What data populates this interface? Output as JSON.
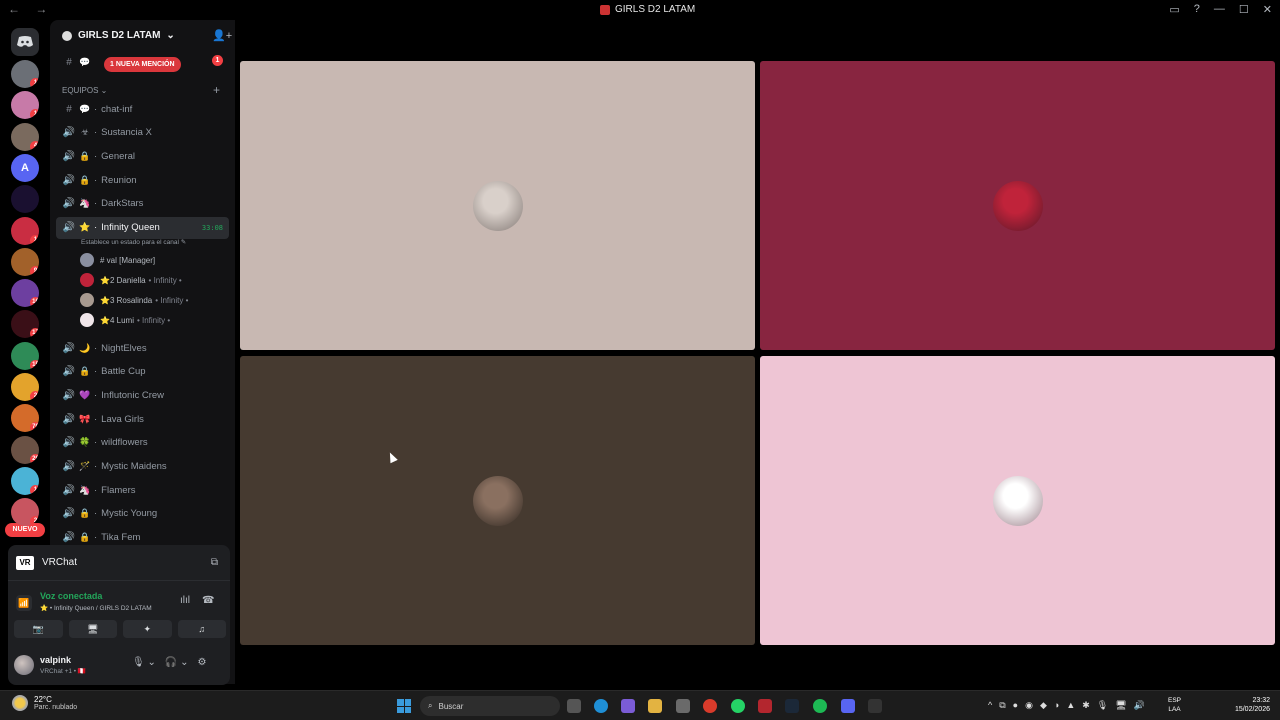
{
  "window": {
    "title": "GIRLS D2 LATAM",
    "nav": "← →",
    "controls": [
      "▭",
      "?",
      "—",
      "☐",
      "✕"
    ]
  },
  "servers": [
    {
      "badge": "1",
      "color": "#6b6f76"
    },
    {
      "badge": "1",
      "color": "#c77aa8"
    },
    {
      "badge": "4",
      "color": "#7a6a5e"
    },
    {
      "badge": "",
      "color": "#5865f2",
      "letter": "A"
    },
    {
      "badge": "",
      "color": "#1a1030"
    },
    {
      "badge": "1",
      "color": "#c92d42"
    },
    {
      "badge": "9",
      "color": "#a2612a"
    },
    {
      "badge": "16",
      "color": "#6d3fa0"
    },
    {
      "badge": "17",
      "color": "#3a0f17"
    },
    {
      "badge": "15",
      "color": "#2e8b57"
    },
    {
      "badge": "2",
      "color": "#e3a32c"
    },
    {
      "badge": "70",
      "color": "#d46b2a"
    },
    {
      "badge": "26",
      "color": "#6a5144"
    },
    {
      "badge": "1",
      "color": "#4bb3d6"
    },
    {
      "badge": "2",
      "color": "#c85560"
    }
  ],
  "nuevo_label": "NUEVO",
  "server_header": {
    "name": "GIRLS D2 LATAM",
    "chevron": "⌄"
  },
  "mention_label": "1 NUEVA MENCIÓN",
  "mention_badge": "1",
  "category": {
    "name": "EQUIPOS ⌄",
    "add": "+"
  },
  "channels": [
    {
      "icon": "#",
      "emoji": "💬",
      "name": "chat-inf",
      "type": "text"
    },
    {
      "icon": "🔊",
      "emoji": "☣",
      "name": "Sustancia X"
    },
    {
      "icon": "🔊",
      "emoji": "🔒",
      "name": "General"
    },
    {
      "icon": "🔊",
      "emoji": "🔒",
      "name": "Reunion"
    },
    {
      "icon": "🔊",
      "emoji": "🦄",
      "name": "DarkStars"
    },
    {
      "icon": "🔊",
      "emoji": "⭐",
      "name": "Infinity Queen",
      "active": true,
      "timer": "33:08"
    }
  ],
  "channel_status": "Establece un estado para el canal ✎",
  "voice_users": [
    {
      "name": "# val [Manager]",
      "sub": "",
      "color": "#8a8fa0"
    },
    {
      "name": "⭐2 Daniella",
      "sub": "• Infinity •",
      "color": "#c0233a"
    },
    {
      "name": "⭐3 Rosalinda",
      "sub": "• Infinity •",
      "color": "#a89a90"
    },
    {
      "name": "⭐4 Lumi",
      "sub": "• Infinity •",
      "color": "#f0e6ea"
    }
  ],
  "channels2": [
    {
      "icon": "🔊",
      "emoji": "🌙",
      "name": "NightElves"
    },
    {
      "icon": "🔊",
      "emoji": "🔒",
      "name": "Battle Cup"
    },
    {
      "icon": "🔊",
      "emoji": "💜",
      "name": "Influtonic Crew"
    },
    {
      "icon": "🔊",
      "emoji": "🎀",
      "name": "Lava Girls"
    },
    {
      "icon": "🔊",
      "emoji": "🍀",
      "name": "wildflowers"
    },
    {
      "icon": "🔊",
      "emoji": "🪄",
      "name": "Mystic Maidens"
    },
    {
      "icon": "🔊",
      "emoji": "🦄",
      "name": "Flamers"
    },
    {
      "icon": "🔊",
      "emoji": "🔒",
      "name": "Mystic Young"
    },
    {
      "icon": "🔊",
      "emoji": "🔒",
      "name": "Tika Fem"
    }
  ],
  "activity": {
    "logo": "VR",
    "name": "VRChat",
    "icon": "⧉"
  },
  "voice": {
    "connected": "Voz conectada",
    "channel": "⭐ • Infinity Queen / GIRLS D2 LATAM",
    "wave_icon": "ılıl",
    "disconnect_icon": "☎"
  },
  "voice_buttons": [
    "📷",
    "🖥",
    "✦",
    "♫"
  ],
  "user": {
    "name": "valpink",
    "status": "VRChat +1 • 🇵🇪",
    "mic": "🎙 ⌄",
    "headset": "🎧 ⌄",
    "settings": "⚙"
  },
  "tiles": [
    {
      "bg": "#c8b8b2",
      "avatar": "#d9d0ca"
    },
    {
      "bg": "#882540",
      "avatar": "#c0233a"
    },
    {
      "bg": "#463a30",
      "avatar": "#8a7060"
    },
    {
      "bg": "#eec5d4",
      "avatar": "#ffffff"
    }
  ],
  "taskbar": {
    "temp": "22°C",
    "weather": "Parc. nublado",
    "search": "Buscar",
    "lang": "ESP\nLAA",
    "time": "23:32",
    "date": "15/02/2026",
    "tray": [
      "^",
      "⧉",
      "●",
      "◉",
      "◆",
      "◑",
      "▲",
      "✱",
      "🎙",
      "🖥",
      "🔊"
    ]
  }
}
